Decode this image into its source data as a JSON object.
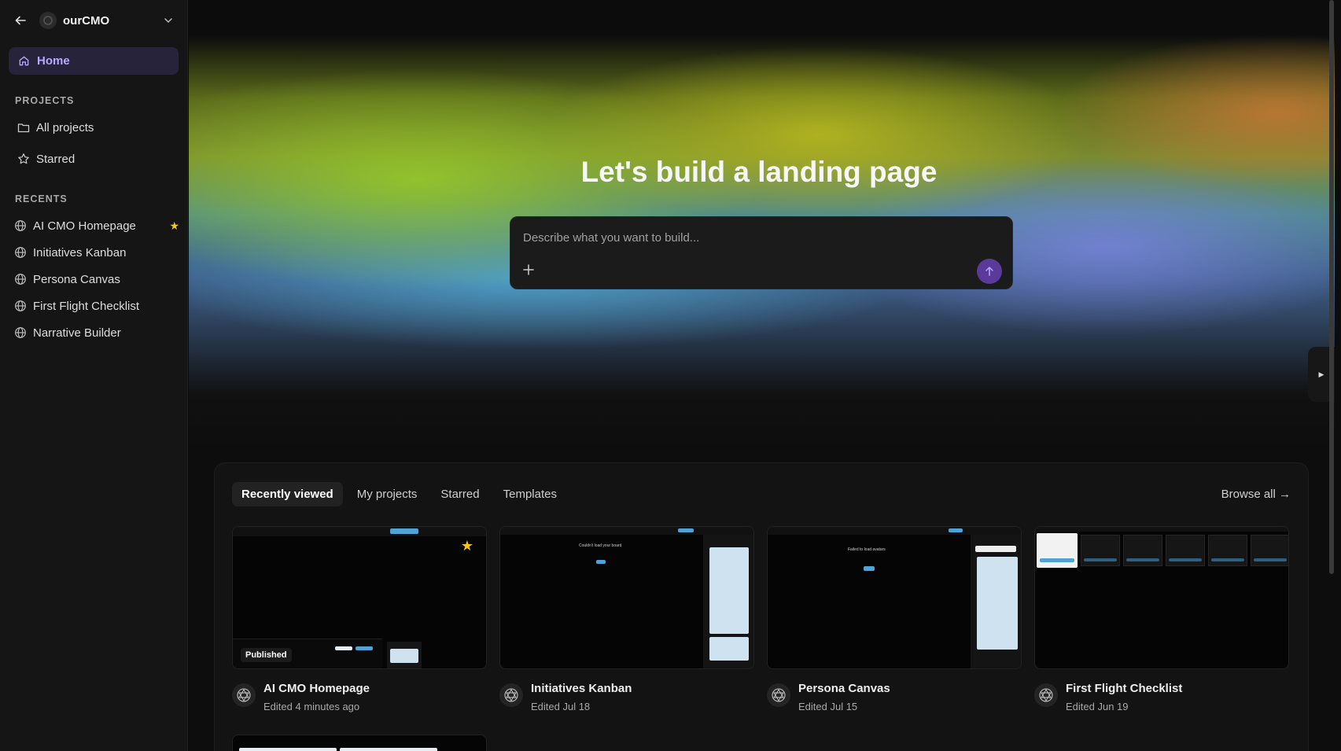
{
  "workspace": {
    "name": "ourCMO"
  },
  "nav": {
    "home_label": "Home"
  },
  "projects_section": {
    "label": "PROJECTS",
    "all_projects": "All projects",
    "starred": "Starred"
  },
  "recents_section": {
    "label": "RECENTS",
    "items": [
      {
        "label": "AI CMO Homepage",
        "starred": true
      },
      {
        "label": "Initiatives Kanban",
        "starred": false
      },
      {
        "label": "Persona Canvas",
        "starred": false
      },
      {
        "label": "First Flight Checklist",
        "starred": false
      },
      {
        "label": "Narrative Builder",
        "starred": false
      }
    ]
  },
  "hero": {
    "title": "Let's build a landing page",
    "prompt_placeholder": "Describe what you want to build..."
  },
  "tabs": [
    {
      "label": "Recently viewed",
      "active": true
    },
    {
      "label": "My projects",
      "active": false
    },
    {
      "label": "Starred",
      "active": false
    },
    {
      "label": "Templates",
      "active": false
    }
  ],
  "browse_all": "Browse all →",
  "cards": [
    {
      "title": "AI CMO Homepage",
      "subtitle": "Edited 4 minutes ago",
      "badge": "Published",
      "starred": true
    },
    {
      "title": "Initiatives Kanban",
      "subtitle": "Edited Jul 18",
      "thumb_text": "Couldn't load your board"
    },
    {
      "title": "Persona Canvas",
      "subtitle": "Edited Jul 15",
      "thumb_text": "Failed to load avatars"
    },
    {
      "title": "First Flight Checklist",
      "subtitle": "Edited Jun 19"
    }
  ],
  "colors": {
    "accent": "#b9a8ff",
    "home_bg": "#26233a",
    "send_button": "#5a3a9a",
    "star": "#f5c518"
  }
}
